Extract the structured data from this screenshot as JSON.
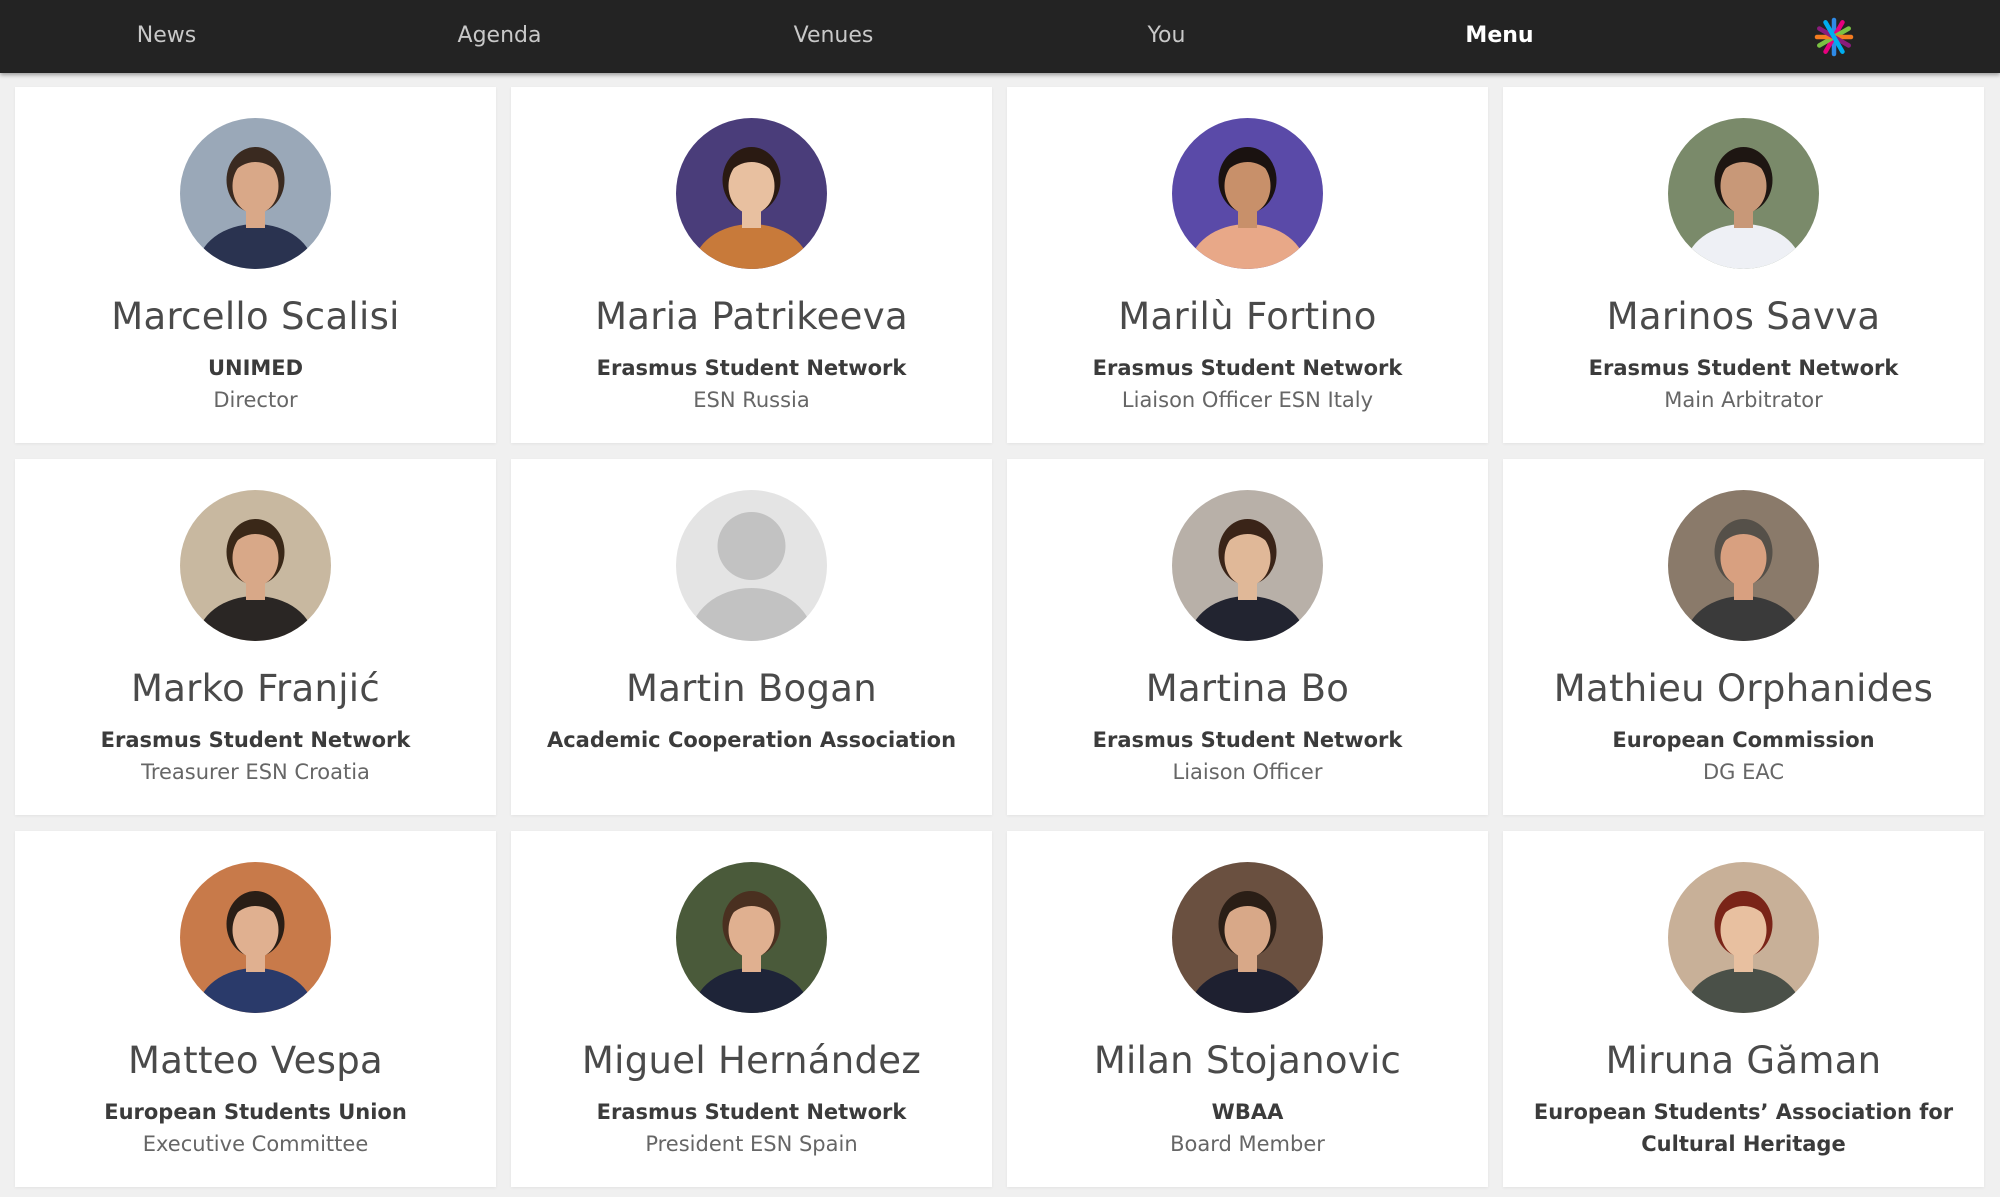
{
  "nav": {
    "items": [
      {
        "label": "News",
        "active": false
      },
      {
        "label": "Agenda",
        "active": false
      },
      {
        "label": "Venues",
        "active": false
      },
      {
        "label": "You",
        "active": false
      },
      {
        "label": "Menu",
        "active": true
      }
    ],
    "logo_icon": "asterisk-logo-icon"
  },
  "colors": {
    "topbar": "#232323",
    "page_background": "#f0f0f0",
    "card_background": "#ffffff",
    "name_text": "#4a4a4a",
    "role_text": "#666666",
    "logo_colors": [
      "#2e8ae6",
      "#e6007e",
      "#7ac143",
      "#f47b20",
      "#8a1c7c",
      "#00aeef"
    ]
  },
  "people": [
    {
      "name": "Marcello Scalisi",
      "org": "UNIMED",
      "role": "Director",
      "photo": {
        "bg": "#9aa8b8",
        "skin": "#d9a888",
        "hair": "#3a2a20",
        "clothes": "#2a3350"
      }
    },
    {
      "name": "Maria Patrikeeva",
      "org": "Erasmus Student Network",
      "role": "ESN Russia",
      "photo": {
        "bg": "#4a3d7a",
        "skin": "#e8c0a0",
        "hair": "#2a1a12",
        "clothes": "#c87a3a"
      }
    },
    {
      "name": "Marilù Fortino",
      "org": "Erasmus Student Network",
      "role": "Liaison Officer ESN Italy",
      "photo": {
        "bg": "#5a4aa8",
        "skin": "#c8906a",
        "hair": "#1a1210",
        "clothes": "#e8a888"
      }
    },
    {
      "name": "Marinos Savva",
      "org": "Erasmus Student Network",
      "role": "Main Arbitrator",
      "photo": {
        "bg": "#7a8a6a",
        "skin": "#c89878",
        "hair": "#1e1612",
        "clothes": "#eef0f5"
      }
    },
    {
      "name": "Marko Franjić",
      "org": "Erasmus Student Network",
      "role": "Treasurer ESN Croatia",
      "photo": {
        "bg": "#c8b8a0",
        "skin": "#d8a888",
        "hair": "#3a2818",
        "clothes": "#2a2624"
      }
    },
    {
      "name": "Martin Bogan",
      "org": "Academic Cooperation Association",
      "role": "",
      "photo": {
        "placeholder": true,
        "bg": "#e4e4e4",
        "silhouette": "#c2c2c2"
      }
    },
    {
      "name": "Martina Bo",
      "org": "Erasmus Student Network",
      "role": "Liaison Officer",
      "photo": {
        "bg": "#b8b0a8",
        "skin": "#e0b898",
        "hair": "#3a2418",
        "clothes": "#222430"
      }
    },
    {
      "name": "Mathieu Orphanides",
      "org": "European Commission",
      "role": "DG EAC",
      "photo": {
        "bg": "#8a7a6a",
        "skin": "#d8a080",
        "hair": "#555049",
        "clothes": "#3a3a3a"
      }
    },
    {
      "name": "Matteo Vespa",
      "org": "European Students Union",
      "role": "Executive Committee",
      "photo": {
        "bg": "#c87a4a",
        "skin": "#e0b090",
        "hair": "#2a1e16",
        "clothes": "#2a3a6a"
      }
    },
    {
      "name": "Miguel Hernández",
      "org": "Erasmus Student Network",
      "role": "President ESN Spain",
      "photo": {
        "bg": "#4a5a3a",
        "skin": "#e0b090",
        "hair": "#4a3020",
        "clothes": "#1e2438"
      }
    },
    {
      "name": "Milan Stojanovic",
      "org": "WBAA",
      "role": "Board Member",
      "photo": {
        "bg": "#6a5040",
        "skin": "#d8a888",
        "hair": "#2a1e16",
        "clothes": "#1e2030"
      }
    },
    {
      "name": "Miruna Găman",
      "org": "European Students’ Association for Cultural Heritage",
      "role": "",
      "photo": {
        "bg": "#c8b098",
        "skin": "#e8c0a0",
        "hair": "#7a2418",
        "clothes": "#4a5048"
      }
    }
  ]
}
